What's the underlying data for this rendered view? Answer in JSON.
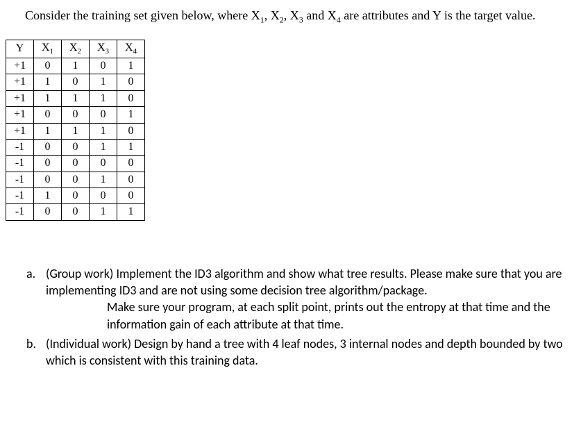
{
  "intro": {
    "text_before": "Consider the training set given below, where X",
    "sub1": "1",
    "text_mid1": ", X",
    "sub2": "2",
    "text_mid2": ", X",
    "sub3": "3",
    "text_mid3": " and X",
    "sub4": "4",
    "text_after": " are attributes and Y is the target value."
  },
  "table": {
    "headers": {
      "y": "Y",
      "x1_base": "X",
      "x1_sub": "1",
      "x2_base": "X",
      "x2_sub": "2",
      "x3_base": "X",
      "x3_sub": "3",
      "x4_base": "X",
      "x4_sub": "4"
    },
    "rows": [
      {
        "y": "+1",
        "x1": "0",
        "x2": "1",
        "x3": "0",
        "x4": "1"
      },
      {
        "y": "+1",
        "x1": "1",
        "x2": "0",
        "x3": "1",
        "x4": "0"
      },
      {
        "y": "+1",
        "x1": "1",
        "x2": "1",
        "x3": "1",
        "x4": "0"
      },
      {
        "y": "+1",
        "x1": "0",
        "x2": "0",
        "x3": "0",
        "x4": "1"
      },
      {
        "y": "+1",
        "x1": "1",
        "x2": "1",
        "x3": "1",
        "x4": "0"
      },
      {
        "y": "-1",
        "x1": "0",
        "x2": "0",
        "x3": "1",
        "x4": "1"
      },
      {
        "y": "-1",
        "x1": "0",
        "x2": "0",
        "x3": "0",
        "x4": "0"
      },
      {
        "y": "-1",
        "x1": "0",
        "x2": "0",
        "x3": "1",
        "x4": "0"
      },
      {
        "y": "-1",
        "x1": "1",
        "x2": "0",
        "x3": "0",
        "x4": "0"
      },
      {
        "y": "-1",
        "x1": "0",
        "x2": "0",
        "x3": "1",
        "x4": "1"
      }
    ]
  },
  "questions": {
    "a": {
      "marker": "a.",
      "line1": "(Group work) Implement the ID3 algorithm and show what tree results. Please make sure that you are implementing ID3 and are not using some decision tree algorithm/package.",
      "line2": "Make sure your program, at each split point, prints out the entropy at that time and the information gain of each attribute at that time."
    },
    "b": {
      "marker": "b.",
      "text": "(Individual work) Design by hand a tree with 4 leaf nodes, 3 internal nodes and depth bounded by two which is consistent with this training data."
    }
  }
}
